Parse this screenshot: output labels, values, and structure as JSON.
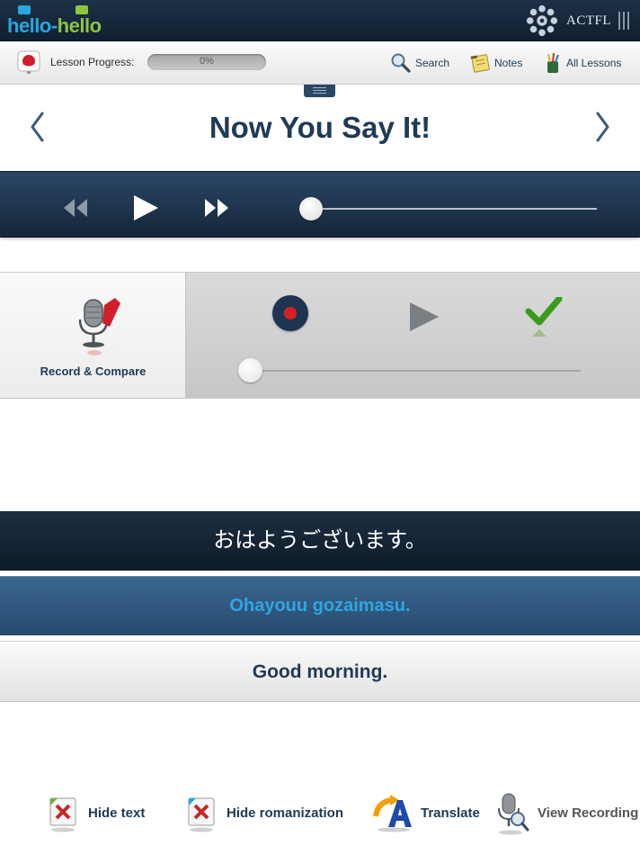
{
  "header": {
    "logo_part1": "hello",
    "logo_dash": "-",
    "logo_part2": "hello",
    "partner": "ACTFL"
  },
  "progress": {
    "label": "Lesson Progress:",
    "percent_text": "0%",
    "value": 0
  },
  "toolbar": {
    "search_label": "Search",
    "notes_label": "Notes",
    "lessons_label": "All Lessons"
  },
  "main": {
    "title": "Now You Say It!"
  },
  "player": {
    "position": 0
  },
  "record": {
    "label": "Record & Compare",
    "position": 0
  },
  "phrase": {
    "japanese": "おはようございます。",
    "romanization": "Ohayouu gozaimasu.",
    "english": "Good morning."
  },
  "bottom": {
    "hide_text": "Hide text",
    "hide_romanization": "Hide romanization",
    "translate": "Translate",
    "view_recording": "View Recording"
  },
  "colors": {
    "navy": "#1f3a56",
    "brand_blue": "#27a8e0",
    "brand_green": "#8cc63f",
    "record_red": "#d62020",
    "check_green": "#3a9a1a"
  }
}
